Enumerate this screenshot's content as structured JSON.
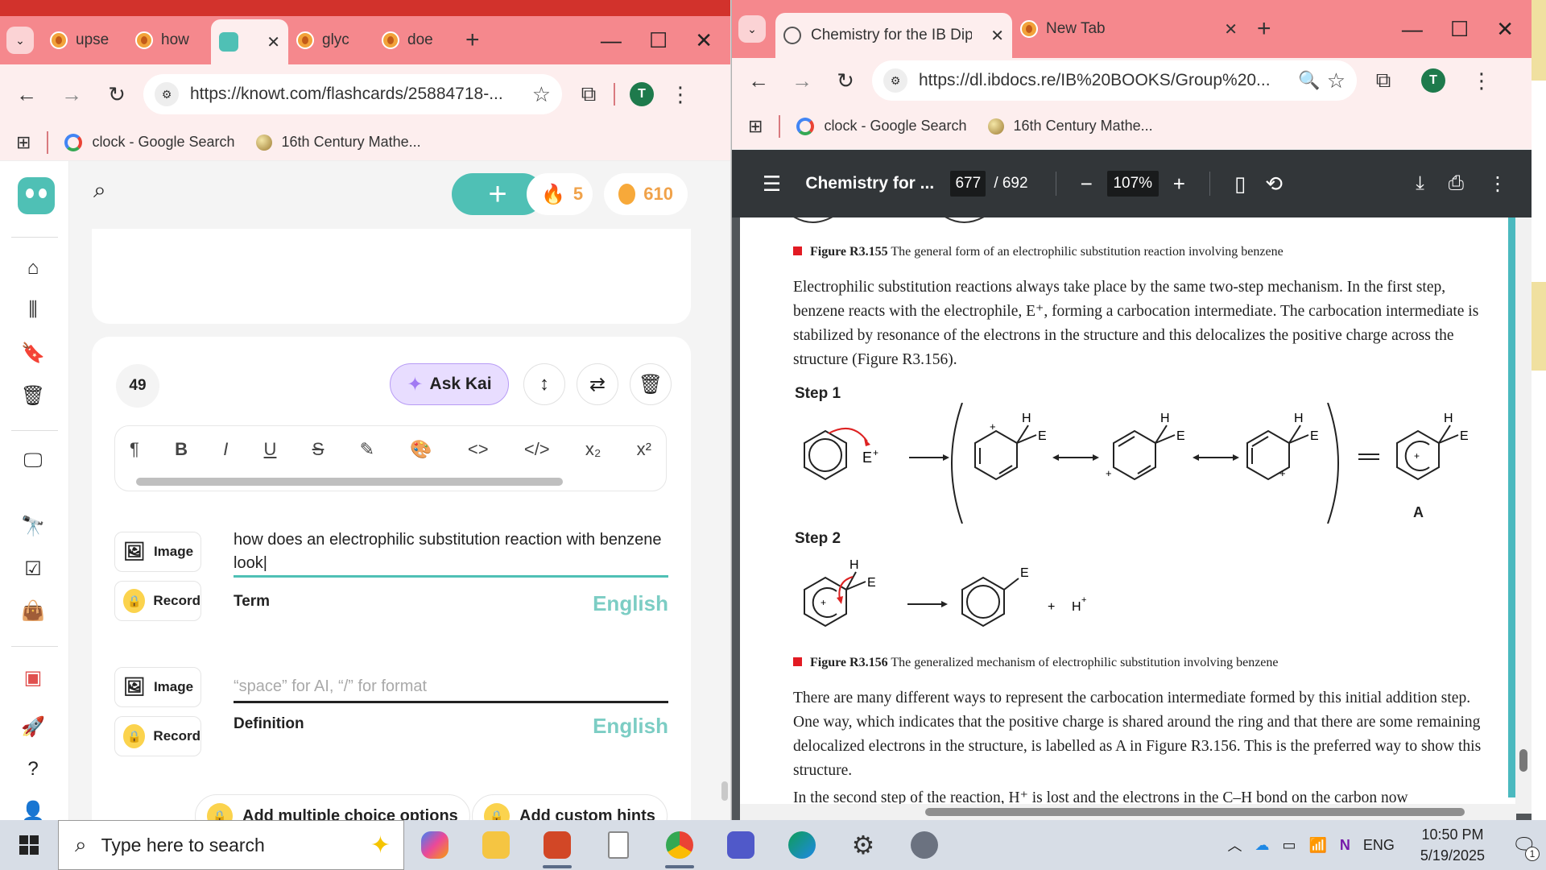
{
  "left_browser": {
    "tabs": [
      {
        "label": "upse"
      },
      {
        "label": "how"
      },
      {
        "label": "",
        "active": true
      },
      {
        "label": "glyc"
      },
      {
        "label": "doe"
      }
    ],
    "url": "https://knowt.com/flashcards/25884718-...",
    "profile_initial": "T",
    "bookmarks": [
      {
        "label": "clock - Google Search"
      },
      {
        "label": "16th Century Mathe..."
      }
    ]
  },
  "knowt": {
    "streak": "5",
    "coins": "610",
    "card_number": "49",
    "ask_kai": "Ask Kai",
    "image_label": "Image",
    "record_label": "Record",
    "term_text": "how does an electrophilic substitution reaction with benzene look",
    "term_label": "Term",
    "definition_placeholder": "“space” for AI, “/” for format",
    "definition_label": "Definition",
    "language": "English",
    "add_mc": "Add multiple choice options",
    "add_hints": "Add custom hints",
    "format_tools": [
      "¶",
      "B",
      "I",
      "U",
      "S",
      "✎",
      "🎨",
      "<>",
      "</>",
      "x₂",
      "x²"
    ]
  },
  "right_browser": {
    "tabs": [
      {
        "label": "Chemistry for the IB Dipl",
        "active": true
      },
      {
        "label": "New Tab"
      }
    ],
    "url": "https://dl.ibdocs.re/IB%20BOOKS/Group%20...",
    "profile_initial": "T",
    "bookmarks": [
      {
        "label": "clock - Google Search"
      },
      {
        "label": "16th Century Mathe..."
      }
    ]
  },
  "pdf": {
    "title": "Chemistry for ...",
    "page": "677",
    "total": "/ 692",
    "zoom": "107%",
    "fig155_label": "Figure R3.155",
    "fig155_text": "The general form of an electrophilic substitution reaction involving benzene",
    "para1": "Electrophilic substitution reactions always take place by the same two-step mechanism. In the first step, benzene reacts with the electrophile, E⁺, forming a carbocation intermediate. The carbocation intermediate is stabilized by resonance of the electrons in the structure and this delocalizes the positive charge across the structure (Figure R3.156).",
    "step1": "Step 1",
    "step2": "Step 2",
    "label_A": "A",
    "fig156_label": "Figure R3.156",
    "fig156_text": "The generalized mechanism of electrophilic substitution involving benzene",
    "para2": "There are many different ways to represent the carbocation intermediate formed by this initial addition step. One way, which indicates that the positive charge is shared around the ring and that there are some remaining delocalized electrons in the structure, is labelled as A in Figure R3.156. This is the preferred way to show this structure.",
    "para3": "In the second step of the reaction, H⁺ is lost and the electrons in the C–H bond on the carbon now"
  },
  "taskbar": {
    "search_placeholder": "Type here to search",
    "lang": "ENG",
    "time": "10:50 PM",
    "date": "5/19/2025",
    "notifications": "1"
  },
  "colors": {
    "knowt_teal": "#4fc0b5",
    "tab_pink": "#f5888d",
    "pdf_toolbar": "#323639",
    "figure_red": "#e21b23"
  }
}
